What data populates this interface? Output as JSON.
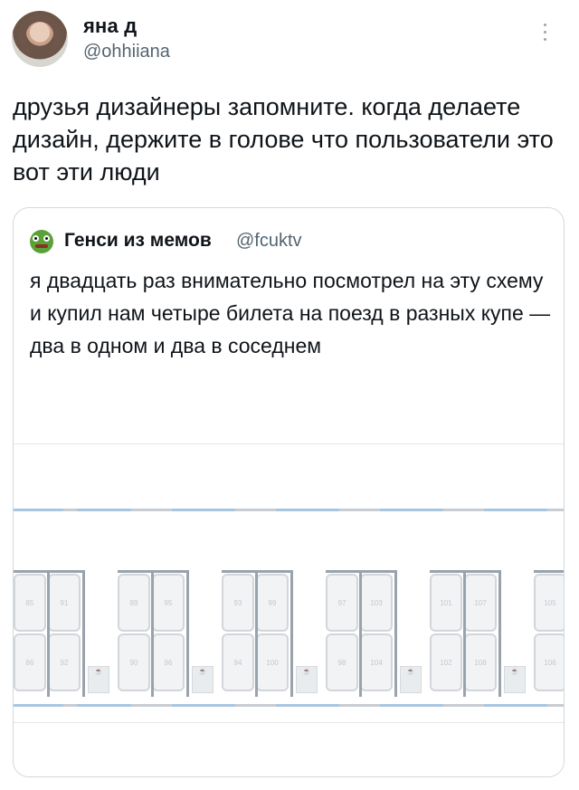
{
  "tweet": {
    "author_name": "яна д",
    "author_handle": "@ohhiiana",
    "text": "друзья дизайнеры запомните. когда делаете дизайн, держите в голове что пользователи это вот эти люди"
  },
  "quote": {
    "author_name": "Генси из мемов",
    "author_handle": "@fcuktv",
    "text": "я двадцать раз внимательно посмотрел на эту схему и купил нам четыре билета на поезд в разных купе — два в одном и два в соседнем"
  },
  "scheme": {
    "seats_top": [
      "85",
      "91",
      "89",
      "95",
      "93",
      "99",
      "97",
      "103",
      "101",
      "107",
      "105"
    ],
    "seats_bottom": [
      "86",
      "92",
      "90",
      "96",
      "94",
      "100",
      "98",
      "104",
      "102",
      "108",
      "106"
    ],
    "table_icon_label": "☕"
  },
  "colors": {
    "accent": "#1d9bf0",
    "muted": "#536471",
    "border": "#cfd9de"
  }
}
